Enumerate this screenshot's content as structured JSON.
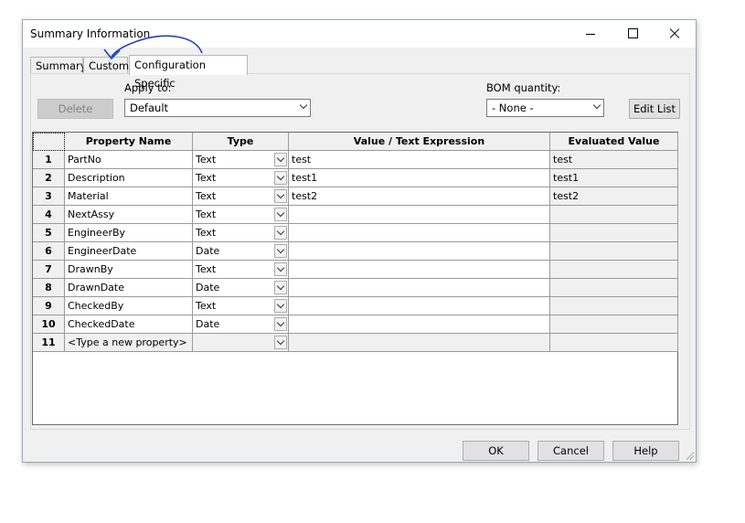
{
  "window": {
    "title": "Summary Information"
  },
  "tabs": [
    {
      "label": "Summary",
      "active": false
    },
    {
      "label": "Custom",
      "active": false
    },
    {
      "label": "Configuration Specific",
      "active": true
    }
  ],
  "toolbar": {
    "delete_label": "Delete",
    "apply_to_label": "Apply to:",
    "apply_to_value": "Default",
    "bom_label": "BOM quantity:",
    "bom_value": "- None -",
    "edit_list_label": "Edit List"
  },
  "table": {
    "headers": [
      "Property Name",
      "Type",
      "Value / Text Expression",
      "Evaluated Value"
    ],
    "rows": [
      {
        "num": "1",
        "name": "PartNo",
        "type": "Text",
        "value": "test",
        "evaluated": "test"
      },
      {
        "num": "2",
        "name": "Description",
        "type": "Text",
        "value": "test1",
        "evaluated": "test1"
      },
      {
        "num": "3",
        "name": "Material",
        "type": "Text",
        "value": "test2",
        "evaluated": "test2"
      },
      {
        "num": "4",
        "name": "NextAssy",
        "type": "Text",
        "value": "",
        "evaluated": ""
      },
      {
        "num": "5",
        "name": "EngineerBy",
        "type": "Text",
        "value": "",
        "evaluated": ""
      },
      {
        "num": "6",
        "name": "EngineerDate",
        "type": "Date",
        "value": "",
        "evaluated": ""
      },
      {
        "num": "7",
        "name": "DrawnBy",
        "type": "Text",
        "value": "",
        "evaluated": ""
      },
      {
        "num": "8",
        "name": "DrawnDate",
        "type": "Date",
        "value": "",
        "evaluated": ""
      },
      {
        "num": "9",
        "name": "CheckedBy",
        "type": "Text",
        "value": "",
        "evaluated": ""
      },
      {
        "num": "10",
        "name": "CheckedDate",
        "type": "Date",
        "value": "",
        "evaluated": ""
      }
    ],
    "new_row": {
      "num": "11",
      "name": "<Type a new property>"
    }
  },
  "footer": {
    "ok_label": "OK",
    "cancel_label": "Cancel",
    "help_label": "Help"
  },
  "colors": {
    "annotation": "#1f3fbf",
    "dialog_bg": "#f0f0f0"
  }
}
